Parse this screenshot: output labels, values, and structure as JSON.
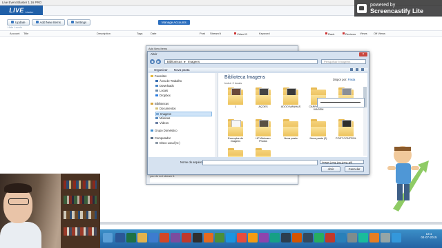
{
  "app": {
    "title": "Live Event Blaster 1.16 PRO",
    "logo_text": "LIVE",
    "logo_sub": "blaster",
    "toolbar": [
      "Update",
      "Add New Items",
      "Settings"
    ],
    "account_button": "Manage Accounts",
    "links_text": "Hide Levels",
    "columns": [
      "Account",
      "Title",
      "Description",
      "Tags",
      "Date",
      "Post",
      "Stream'd",
      "Video ID",
      "Keyword",
      "Rank",
      "Reviews",
      "Views",
      "Off Views"
    ],
    "status_text": "you do not stream it."
  },
  "behind_dialog": {
    "title": "Add New Items"
  },
  "dialog": {
    "title": "Abrir",
    "path": [
      "Bibliotecas",
      "Imagens"
    ],
    "search_placeholder": "Pesquisar Imagens",
    "commands": [
      "Organizar",
      "Nova pasta"
    ],
    "tree": [
      {
        "label": "Favoritos",
        "kind": "star"
      },
      {
        "label": "Área de Trabalho",
        "kind": "desk"
      },
      {
        "label": "Downloads",
        "kind": "down"
      },
      {
        "label": "Locais",
        "kind": "loc"
      },
      {
        "label": "Dropbox",
        "kind": "drop"
      },
      {
        "label": "Bibliotecas",
        "kind": "lib"
      },
      {
        "label": "Documentos",
        "kind": "doc"
      },
      {
        "label": "Imagens",
        "kind": "img"
      },
      {
        "label": "Músicas",
        "kind": "mus"
      },
      {
        "label": "Vídeos",
        "kind": "vid"
      },
      {
        "label": "Grupo Doméstico",
        "kind": "grp"
      },
      {
        "label": "Computador",
        "kind": "pc"
      },
      {
        "label": "Disco Local (C:)",
        "kind": "disk"
      }
    ],
    "library_title": "Biblioteca Imagens",
    "library_sub": "Inclui: 2 locais",
    "arrange_label": "Dispor por:",
    "arrange_value": "Pasta",
    "files": [
      {
        "label": "1"
      },
      {
        "label": "AÇOES"
      },
      {
        "label": "ADOO MANHAS"
      },
      {
        "label": "CARROS PARA VIAGEM"
      },
      {
        "label": "corvo usados"
      },
      {
        "label": "Exemplos de imagens"
      },
      {
        "label": "HP Webcam Photos"
      },
      {
        "label": "Nova pasta"
      },
      {
        "label": "Nova pasta (2)"
      },
      {
        "label": "POST CONTROL"
      }
    ],
    "filename_label": "Nome do arquivo:",
    "filetype": "Image (.png,.jpg,.jpeg,.gif)",
    "open_button": "Abrir",
    "cancel_button": "Cancelar"
  },
  "watermark": {
    "line1": "powered by",
    "line2": "Screencastify Lite"
  },
  "clock": {
    "time": "13:1",
    "date": "04-07-2015"
  }
}
